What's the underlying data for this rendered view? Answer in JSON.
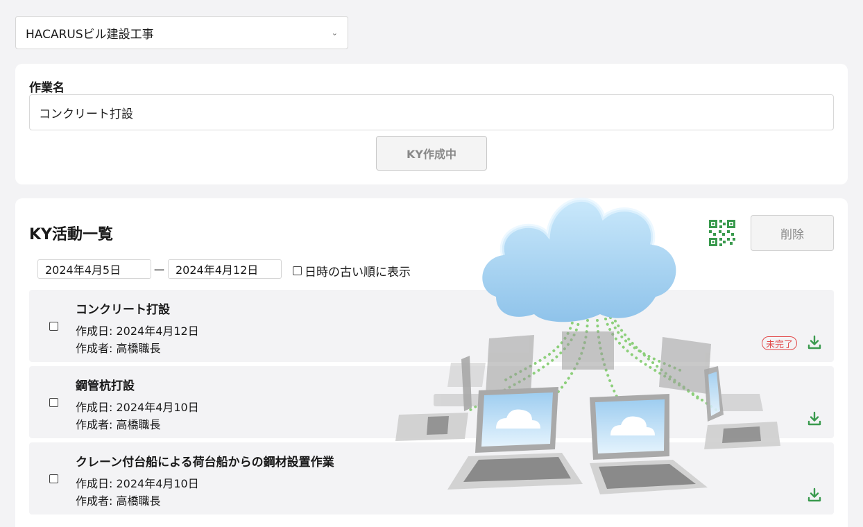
{
  "project_select": {
    "value": "HACARUSビル建設工事"
  },
  "form": {
    "label": "作業名",
    "task_value": "コンクリート打設",
    "submit_label": "KY作成中"
  },
  "list": {
    "title": "KY活動一覧",
    "delete_label": "削除",
    "date_from": "2024年4月5日",
    "date_sep": "ー",
    "date_to": "2024年4月12日",
    "sort_label": "日時の古い順に表示",
    "items": [
      {
        "title": "コンクリート打設",
        "date": "作成日: 2024年4月12日",
        "author": "作成者: 高橋職長",
        "status": "未完了"
      },
      {
        "title": "鋼管杭打設",
        "date": "作成日: 2024年4月10日",
        "author": "作成者: 高橋職長",
        "status": ""
      },
      {
        "title": "クレーン付台船による荷台船からの鋼材設置作業",
        "date": "作成日: 2024年4月10日",
        "author": "作成者: 高橋職長",
        "status": ""
      }
    ]
  },
  "colors": {
    "accent_green": "#3a9a4e",
    "badge_red": "#e24a4a",
    "cloud_blue": "#a9d4f2"
  },
  "icons": {
    "qr": "qr-code-icon",
    "download": "download-icon",
    "select": "chevron-down-icon"
  }
}
